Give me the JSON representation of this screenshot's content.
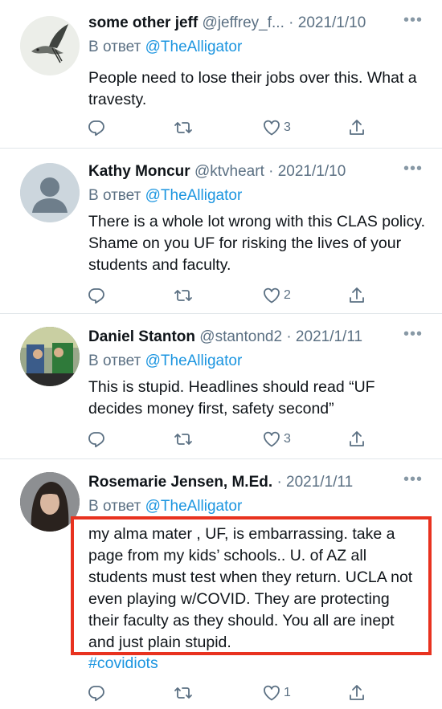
{
  "tweets": [
    {
      "name": "some other jeff",
      "handle": "@jeffrey_f...",
      "date": "· 2021/1/10",
      "reply_prefix": "В ответ",
      "reply_to": "@TheAlligator",
      "text": "People need to lose their jobs over this. What a travesty.",
      "likes": "3",
      "avatar": "bird-avatar"
    },
    {
      "name": "Kathy Moncur",
      "handle": "@ktvheart",
      "date": "· 2021/1/10",
      "reply_prefix": "В ответ",
      "reply_to": "@TheAlligator",
      "text": "There is a whole lot wrong with this CLAS policy.  Shame on you UF for risking the lives of your students and faculty.",
      "likes": "2",
      "avatar": "default-avatar"
    },
    {
      "name": "Daniel Stanton",
      "handle": "@stantond2",
      "date": "· 2021/1/11",
      "reply_prefix": "В ответ",
      "reply_to": "@TheAlligator",
      "text": "This is stupid. Headlines should read “UF decides money first, safety second”",
      "likes": "3",
      "avatar": "photo-avatar"
    },
    {
      "name": "Rosemarie Jensen, M.Ed.",
      "handle": "",
      "date": "· 2021/1/11",
      "reply_prefix": "В ответ",
      "reply_to": "@TheAlligator",
      "text": "my alma mater , UF,  is embarrassing. take a page from my kids’ schools.. U. of AZ all students must test when they return. UCLA not even playing w/COVID. They are protecting their faculty as they should. You all are inept and just plain stupid.",
      "hashtag": "#covidiots",
      "likes": "1",
      "avatar": "person-photo-avatar"
    }
  ],
  "icons": [
    "reply-icon",
    "retweet-icon",
    "like-icon",
    "share-icon",
    "more-icon"
  ],
  "colors": {
    "link": "#1b95e0",
    "secondary": "#5b7083",
    "highlight": "#e8321f"
  }
}
